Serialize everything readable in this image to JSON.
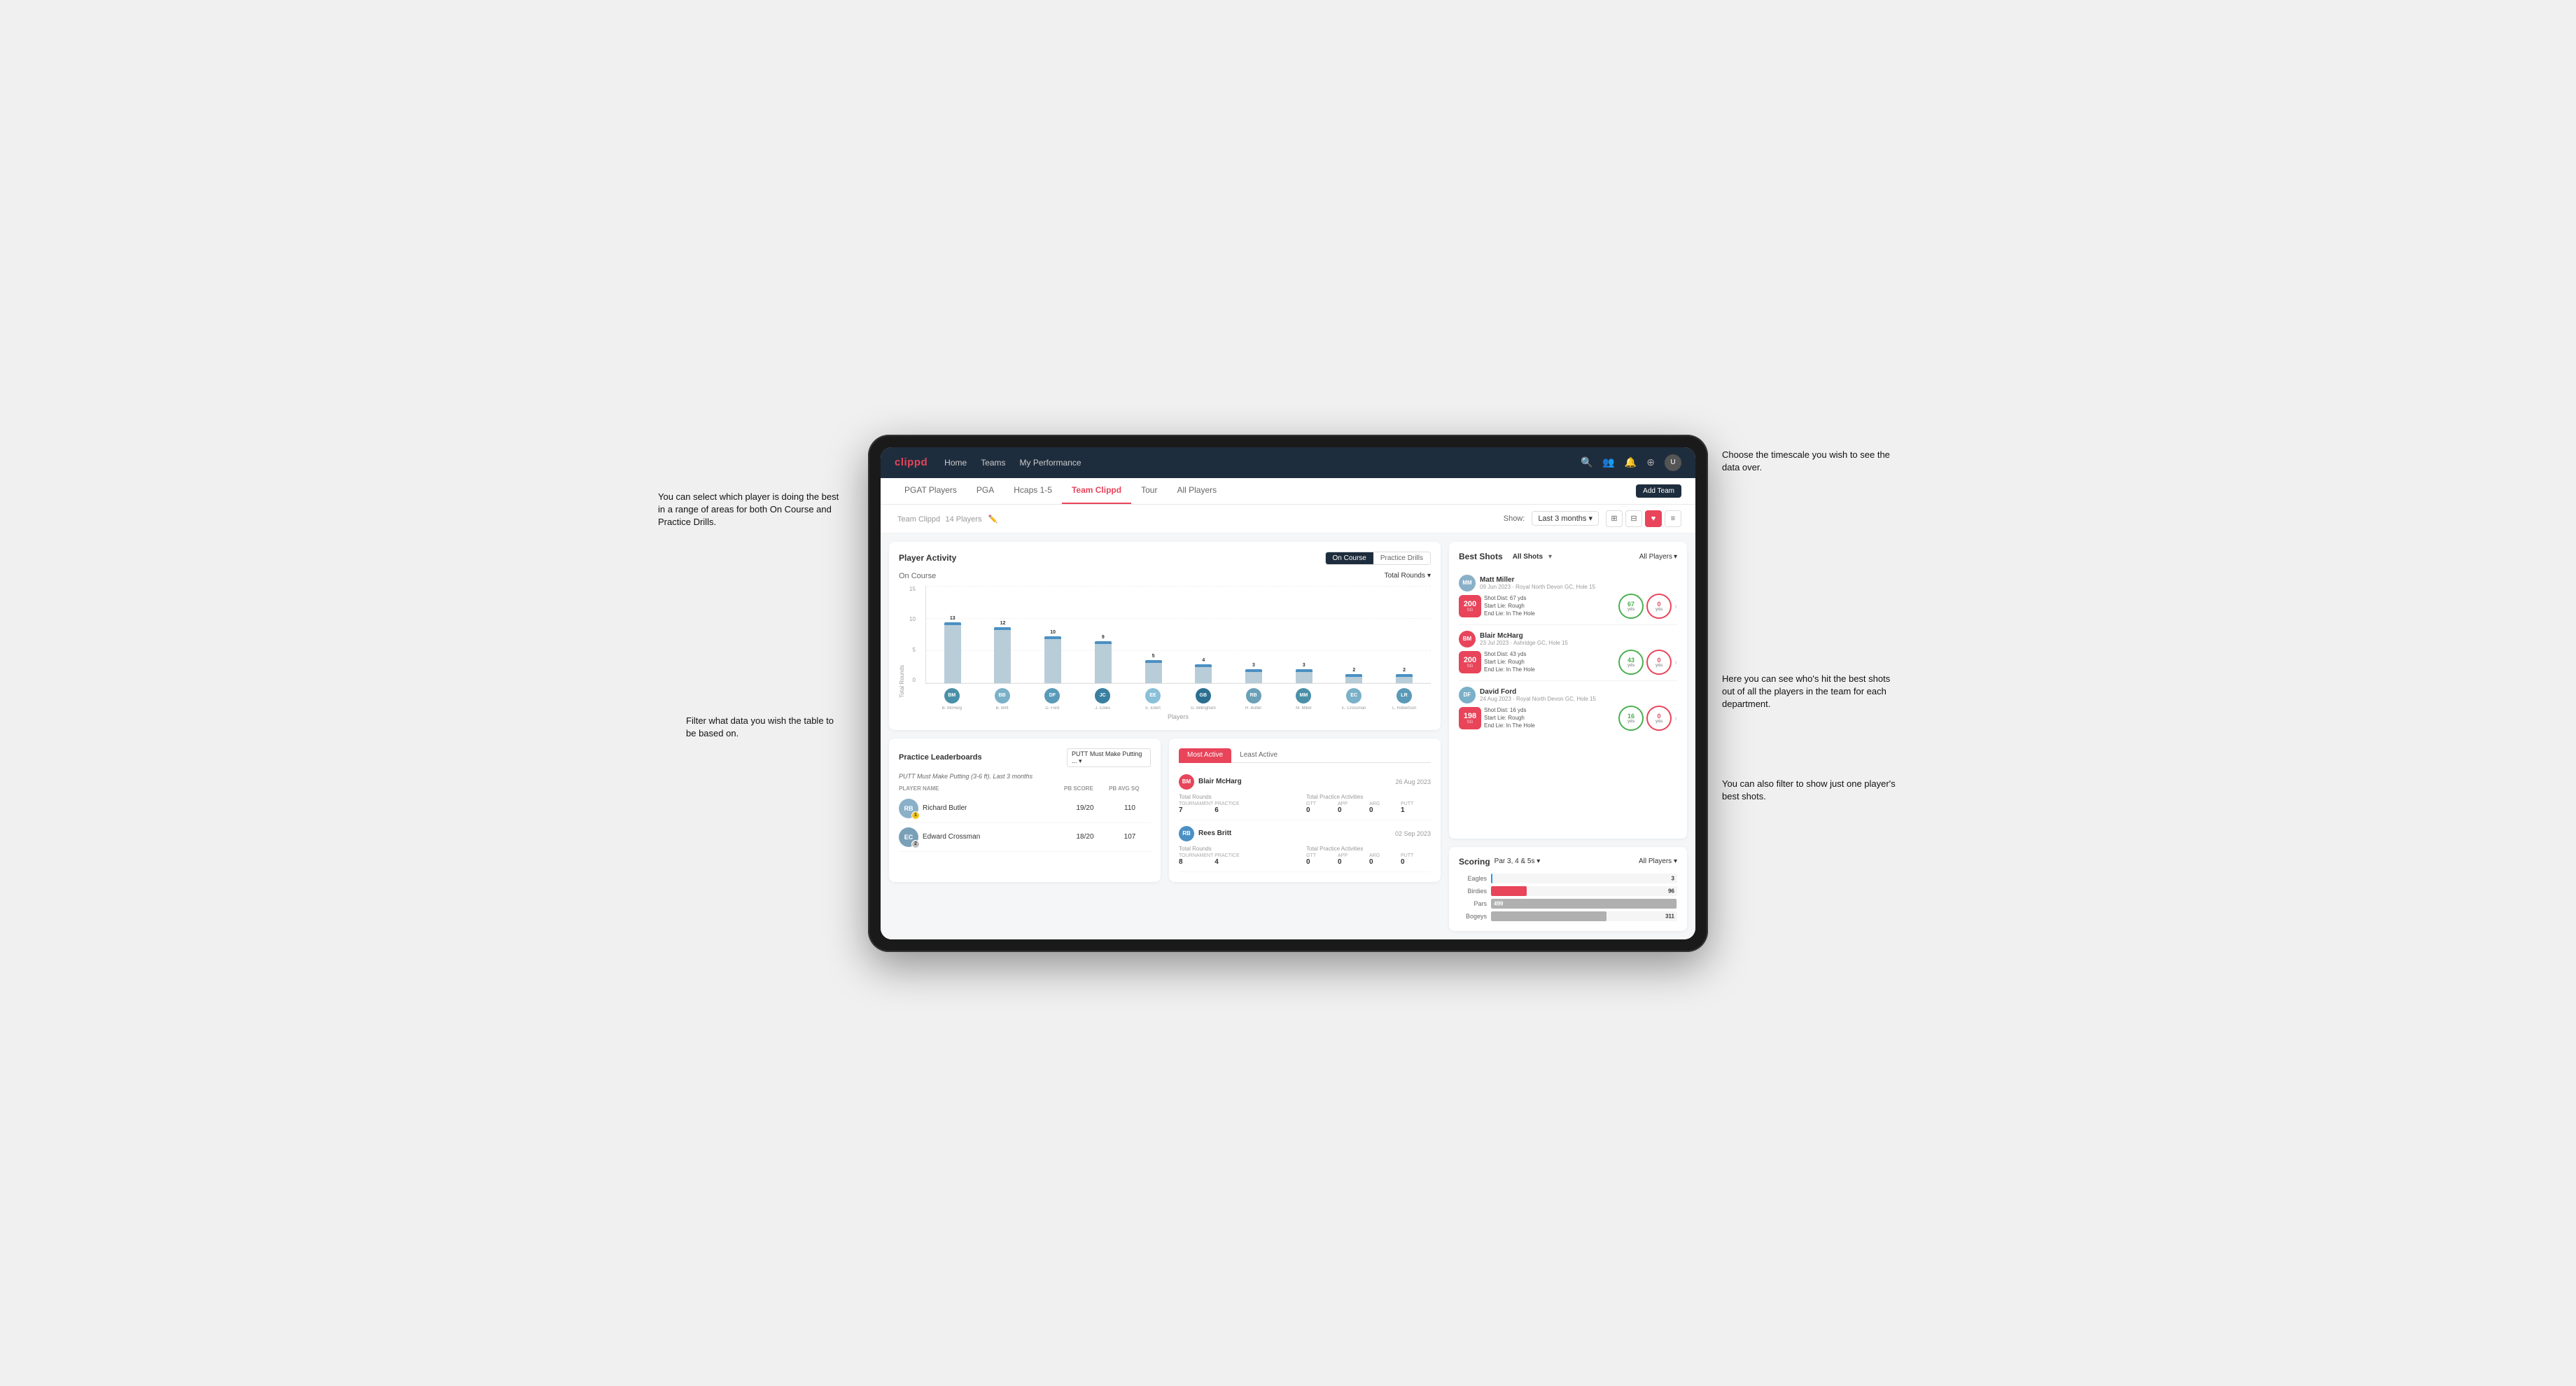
{
  "annotations": {
    "top_right": "Choose the timescale you wish to see the data over.",
    "left_top": "You can select which player is doing the best in a range of areas for both On Course and Practice Drills.",
    "left_bottom": "Filter what data you wish the table to be based on.",
    "right_mid": "Here you can see who's hit the best shots out of all the players in the team for each department.",
    "right_bottom": "You can also filter to show just one player's best shots."
  },
  "nav": {
    "logo": "clippd",
    "links": [
      "Home",
      "Teams",
      "My Performance"
    ],
    "icons": [
      "🔍",
      "👥",
      "🔔",
      "⊕",
      "👤"
    ]
  },
  "sub_nav": {
    "tabs": [
      "PGAT Players",
      "PGA",
      "Hcaps 1-5",
      "Team Clippd",
      "Tour",
      "All Players"
    ],
    "active": "Team Clippd",
    "add_button": "Add Team"
  },
  "team_header": {
    "title": "Team Clippd",
    "subtitle": "14 Players",
    "show_label": "Show:",
    "show_value": "Last 3 months",
    "views": [
      "⊞",
      "⊟",
      "♥",
      "≡"
    ]
  },
  "player_activity": {
    "title": "Player Activity",
    "toggle_on_course": "On Course",
    "toggle_practice": "Practice Drills",
    "section_title": "On Course",
    "chart_label": "Total Rounds",
    "y_labels": [
      "15",
      "10",
      "5",
      "0"
    ],
    "y_title": "Total Rounds",
    "x_label": "Players",
    "bars": [
      {
        "player": "B. McHarg",
        "value": 13,
        "height": 87,
        "color": "#b8cdd8"
      },
      {
        "player": "B. Britt",
        "value": 12,
        "height": 80,
        "color": "#b8cdd8"
      },
      {
        "player": "D. Ford",
        "value": 10,
        "height": 67,
        "color": "#b8cdd8"
      },
      {
        "player": "J. Coles",
        "value": 9,
        "height": 60,
        "color": "#b8cdd8"
      },
      {
        "player": "E. Ebert",
        "value": 5,
        "height": 33,
        "color": "#b8cdd8"
      },
      {
        "player": "G. Billingham",
        "value": 4,
        "height": 27,
        "color": "#b8cdd8"
      },
      {
        "player": "R. Butler",
        "value": 3,
        "height": 20,
        "color": "#b8cdd8"
      },
      {
        "player": "M. Miller",
        "value": 3,
        "height": 20,
        "color": "#b8cdd8"
      },
      {
        "player": "E. Crossman",
        "value": 2,
        "height": 13,
        "color": "#b8cdd8"
      },
      {
        "player": "L. Robertson",
        "value": 2,
        "height": 13,
        "color": "#b8cdd8"
      }
    ],
    "avatar_colors": [
      "#4a8fa8",
      "#7ab0c8",
      "#5a9ab8",
      "#3a7fa0",
      "#8ac0d8",
      "#2a6f90",
      "#6aa0b8",
      "#4a8fa8",
      "#7ab0c8",
      "#5a9ab8"
    ]
  },
  "practice_leaderboards": {
    "title": "Practice Leaderboards",
    "select_label": "PUTT Must Make Putting ...",
    "subtitle": "PUTT Must Make Putting (3-6 ft). Last 3 months",
    "columns": [
      "PLAYER NAME",
      "PB SCORE",
      "PB AVG SQ"
    ],
    "rows": [
      {
        "name": "Richard Butler",
        "rank": 1,
        "score": "19/20",
        "avg": "110",
        "avatar_color": "#8ab0c8",
        "badge_color": "#f5c518"
      },
      {
        "name": "Edward Crossman",
        "rank": 2,
        "score": "18/20",
        "avg": "107",
        "avatar_color": "#7aa0b8",
        "badge_color": "#c0c0c0"
      }
    ]
  },
  "most_active": {
    "tabs": [
      "Most Active",
      "Least Active"
    ],
    "active_tab": "Most Active",
    "players": [
      {
        "name": "Blair McHarg",
        "date": "26 Aug 2023",
        "avatar_color": "#e8445a",
        "total_rounds_label": "Total Rounds",
        "tournament": "7",
        "practice": "6",
        "total_practice_label": "Total Practice Activities",
        "gtt": "0",
        "app": "0",
        "arg": "0",
        "putt": "1"
      },
      {
        "name": "Rees Britt",
        "date": "02 Sep 2023",
        "avatar_color": "#4a90c4",
        "total_rounds_label": "Total Rounds",
        "tournament": "8",
        "practice": "4",
        "total_practice_label": "Total Practice Activities",
        "gtt": "0",
        "app": "0",
        "arg": "0",
        "putt": "0"
      }
    ]
  },
  "best_shots": {
    "title": "Best Shots",
    "tabs": [
      "All Shots",
      "Players"
    ],
    "all_players_label": "All Players",
    "shots": [
      {
        "name": "Matt Miller",
        "date": "09 Jun 2023",
        "course": "Royal North Devon GC",
        "hole": "Hole 15",
        "badge_num": "200",
        "badge_label": "SG",
        "badge_color": "#e8445a",
        "info": "Shot Dist: 67 yds\nStart Lie: Rough\nEnd Lie: In The Hole",
        "metric1": "67",
        "metric1_unit": "yds",
        "metric1_color": "green",
        "metric2": "0",
        "metric2_unit": "yds",
        "metric2_color": "pink",
        "avatar_color": "#8ab0c8"
      },
      {
        "name": "Blair McHarg",
        "date": "23 Jul 2023",
        "course": "Ashridge GC",
        "hole": "Hole 15",
        "badge_num": "200",
        "badge_label": "SG",
        "badge_color": "#e8445a",
        "info": "Shot Dist: 43 yds\nStart Lie: Rough\nEnd Lie: In The Hole",
        "metric1": "43",
        "metric1_unit": "yds",
        "metric1_color": "green",
        "metric2": "0",
        "metric2_unit": "yds",
        "metric2_color": "pink",
        "avatar_color": "#e8445a"
      },
      {
        "name": "David Ford",
        "date": "24 Aug 2023",
        "course": "Royal North Devon GC",
        "hole": "Hole 15",
        "badge_num": "198",
        "badge_label": "SG",
        "badge_color": "#e8445a",
        "info": "Shot Dist: 16 yds\nStart Lie: Rough\nEnd Lie: In The Hole",
        "metric1": "16",
        "metric1_unit": "yds",
        "metric1_color": "green",
        "metric2": "0",
        "metric2_unit": "yds",
        "metric2_color": "pink",
        "avatar_color": "#7ab0c8"
      }
    ]
  },
  "scoring": {
    "title": "Scoring",
    "select1": "Par 3, 4 & 5s",
    "select2": "All Players",
    "rows": [
      {
        "label": "Eagles",
        "value": 3,
        "max": 500,
        "color": "#2196F3",
        "bar_pct": 0.6
      },
      {
        "label": "Birdies",
        "value": 96,
        "max": 500,
        "color": "#e8445a",
        "bar_pct": 19.2
      },
      {
        "label": "Pars",
        "value": 499,
        "max": 500,
        "color": "#b0b0b0",
        "bar_pct": 99.8
      },
      {
        "label": "Bogeys",
        "value": 311,
        "max": 500,
        "color": "#b0b0b0",
        "bar_pct": 62.2
      }
    ]
  }
}
